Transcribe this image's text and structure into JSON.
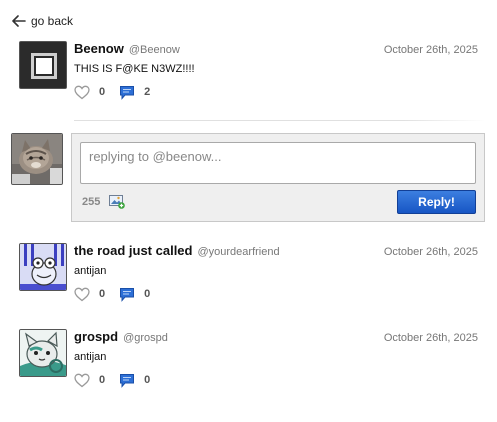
{
  "nav": {
    "go_back_label": "go back"
  },
  "main_post": {
    "display_name": "Beenow",
    "handle": "@Beenow",
    "date": "October 26th, 2025",
    "text": "THIS IS F@KE N3WZ!!!!",
    "likes": "0",
    "replies": "2"
  },
  "reply_form": {
    "placeholder": "replying to @beenow...",
    "char_count": "255",
    "submit_label": "Reply!"
  },
  "replies": [
    {
      "display_name": "the road just called",
      "handle": "@yourdearfriend",
      "date": "October 26th, 2025",
      "text": "antijan",
      "likes": "0",
      "replies": "0"
    },
    {
      "display_name": "grospd",
      "handle": "@grospd",
      "date": "October 26th, 2025",
      "text": "antijan",
      "likes": "0",
      "replies": "0"
    }
  ],
  "colors": {
    "accent": "#1f5fd0",
    "muted": "#777777",
    "reply_box_bg": "#efefef"
  },
  "icons": [
    "arrow-left-icon",
    "heart-icon",
    "speech-bubble-icon",
    "image-upload-icon"
  ]
}
